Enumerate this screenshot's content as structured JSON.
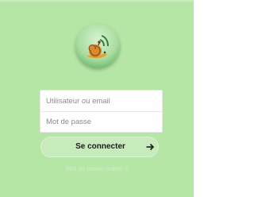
{
  "login": {
    "logo_icon": "snail-wifi-logo-icon",
    "username_placeholder": "Utilisateur ou email",
    "password_placeholder": "Mot de passe",
    "submit_label": "Se connecter",
    "submit_icon": "arrow-right-icon",
    "forgot_password": "Mot de passe oublié ?"
  },
  "colors": {
    "background": "#b5e6a6",
    "button": "#c7ebbb",
    "logo_green": "#3fa34a",
    "snail_orange": "#e2a23a"
  }
}
